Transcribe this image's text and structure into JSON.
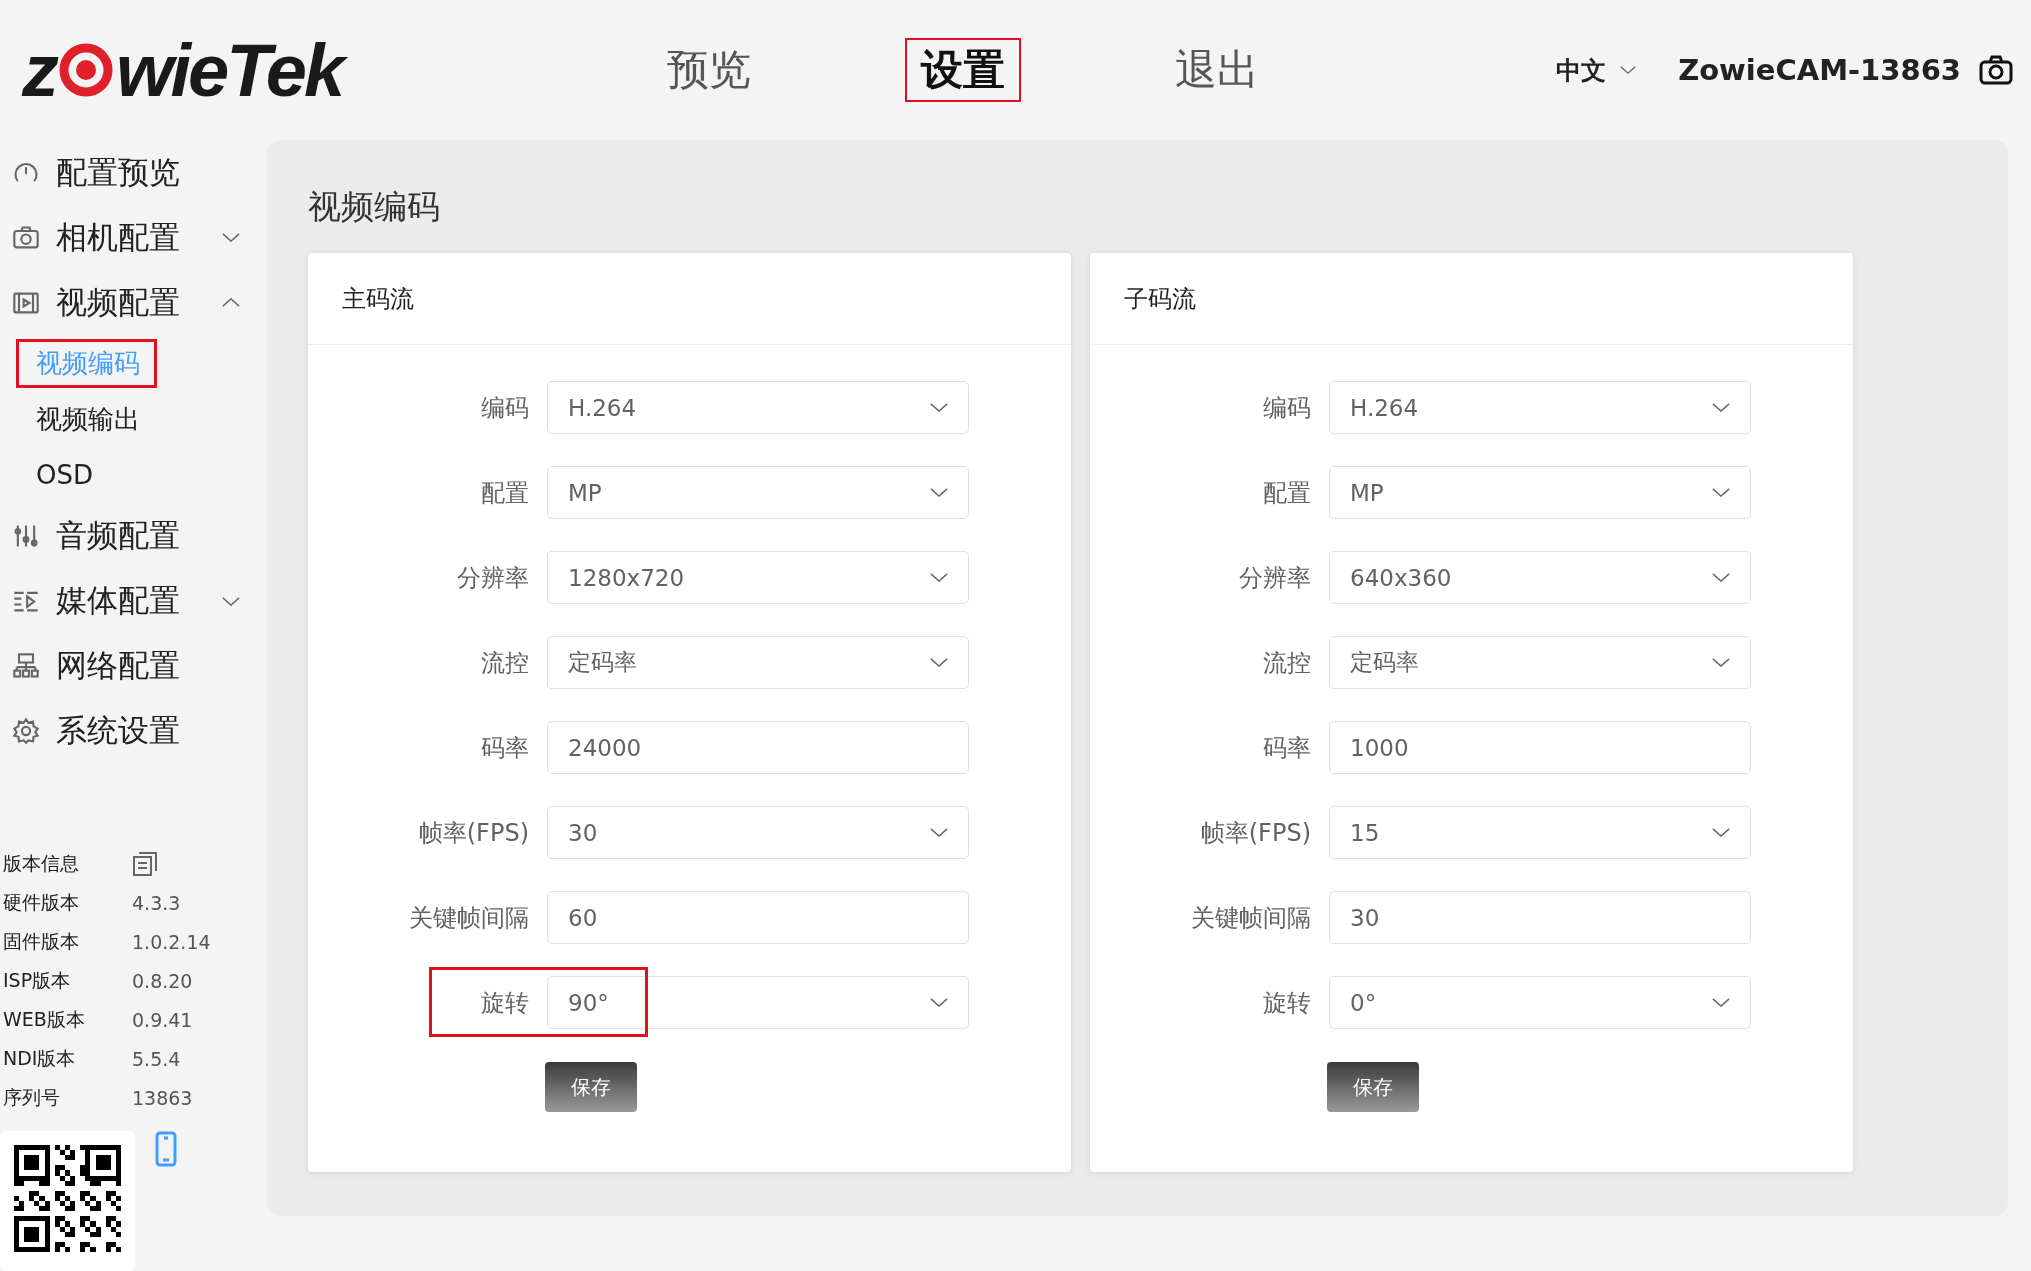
{
  "logo": {
    "before": "z",
    "after": "wie",
    "tail": "Tek"
  },
  "nav": [
    {
      "label": "预览",
      "selected": false,
      "highlighted": false
    },
    {
      "label": "设置",
      "selected": true,
      "highlighted": true
    },
    {
      "label": "退出",
      "selected": false,
      "highlighted": false
    }
  ],
  "header_right": {
    "language": "中文",
    "device": "ZowieCAM-13863"
  },
  "sidebar": {
    "items": [
      {
        "label": "配置预览"
      },
      {
        "label": "相机配置",
        "expanded": false
      },
      {
        "label": "视频配置",
        "expanded": true,
        "children": [
          {
            "label": "视频编码",
            "selected": true,
            "highlighted": true
          },
          {
            "label": "视频输出",
            "selected": false,
            "highlighted": false
          },
          {
            "label": "OSD",
            "selected": false,
            "highlighted": false
          }
        ]
      },
      {
        "label": "音频配置"
      },
      {
        "label": "媒体配置",
        "expanded": false
      },
      {
        "label": "网络配置"
      },
      {
        "label": "系统设置"
      }
    ]
  },
  "version_info": {
    "title": "版本信息",
    "rows": [
      {
        "label": "硬件版本",
        "value": "4.3.3"
      },
      {
        "label": "固件版本",
        "value": "1.0.2.14"
      },
      {
        "label": "ISP版本",
        "value": "0.8.20"
      },
      {
        "label": "WEB版本",
        "value": "0.9.41"
      },
      {
        "label": "NDI版本",
        "value": "5.5.4"
      },
      {
        "label": "序列号",
        "value": "13863"
      }
    ]
  },
  "main": {
    "title": "视频编码",
    "panels": [
      {
        "title": "主码流",
        "button": "保存",
        "fields": [
          {
            "label": "编码",
            "value": "H.264",
            "kind": "select",
            "highlighted": false
          },
          {
            "label": "配置",
            "value": "MP",
            "kind": "select",
            "highlighted": false
          },
          {
            "label": "分辨率",
            "value": "1280x720",
            "kind": "select",
            "highlighted": false
          },
          {
            "label": "流控",
            "value": "定码率",
            "kind": "select",
            "highlighted": false
          },
          {
            "label": "码率",
            "value": "24000",
            "kind": "input",
            "highlighted": false
          },
          {
            "label": "帧率(FPS)",
            "value": "30",
            "kind": "select",
            "highlighted": false
          },
          {
            "label": "关键帧间隔",
            "value": "60",
            "kind": "input",
            "highlighted": false
          },
          {
            "label": "旋转",
            "value": "90°",
            "kind": "select",
            "highlighted": true
          }
        ]
      },
      {
        "title": "子码流",
        "button": "保存",
        "fields": [
          {
            "label": "编码",
            "value": "H.264",
            "kind": "select",
            "highlighted": false
          },
          {
            "label": "配置",
            "value": "MP",
            "kind": "select",
            "highlighted": false
          },
          {
            "label": "分辨率",
            "value": "640x360",
            "kind": "select",
            "highlighted": false
          },
          {
            "label": "流控",
            "value": "定码率",
            "kind": "select",
            "highlighted": false
          },
          {
            "label": "码率",
            "value": "1000",
            "kind": "input",
            "highlighted": false
          },
          {
            "label": "帧率(FPS)",
            "value": "15",
            "kind": "select",
            "highlighted": false
          },
          {
            "label": "关键帧间隔",
            "value": "30",
            "kind": "input",
            "highlighted": false
          },
          {
            "label": "旋转",
            "value": "0°",
            "kind": "select",
            "highlighted": false
          }
        ]
      }
    ]
  }
}
